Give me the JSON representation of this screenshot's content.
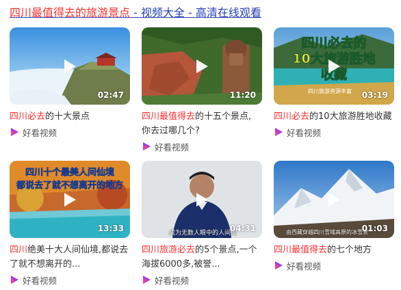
{
  "header": {
    "title_prefix": "四川最值得去的旅游景点",
    "title_suffix": " - 视频大全 - 高清在线观看",
    "link_color": "#2440b3",
    "highlight_color": "#f73131"
  },
  "source_label": "好看视频",
  "cards": [
    {
      "title_parts": [
        "四川",
        "必去",
        "的十大景点"
      ],
      "duration": "02:47",
      "overlay": ""
    },
    {
      "title_parts": [
        "四川最值得去",
        "的十五个景点,",
        "你去过哪几个?"
      ],
      "duration": "11:20",
      "overlay": ""
    },
    {
      "title_parts": [
        "四川",
        "必去",
        "的10大旅游胜地收藏"
      ],
      "duration": "03:19",
      "overlay": "四川必去的\n10大旅游胜地\n收藏",
      "overlay_sub": "四川旅游资源丰富"
    },
    {
      "title_parts": [
        "四川",
        "绝美十大人间仙境,都说去",
        "了就不想离开的..."
      ],
      "duration": "13:33",
      "overlay": "四川十个最美人间仙境\n都说去了就不想离开的地方"
    },
    {
      "title_parts": [
        "四川",
        "旅游",
        "必去",
        "的5个景点,一个",
        "海拔6000多,被誉..."
      ],
      "duration": "04:31",
      "overlay": "成为无数人眼中的人间仙"
    },
    {
      "title_parts": [
        "四川最值得去",
        "的七个地方"
      ],
      "duration": "01:03",
      "overlay": "由西藏穿越四川雪域高原的冰雪景"
    }
  ]
}
